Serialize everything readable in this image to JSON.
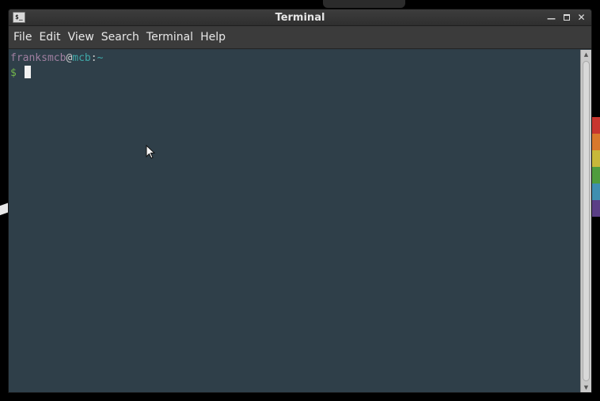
{
  "window": {
    "title": "Terminal",
    "icon_label": "$_",
    "controls": {
      "minimize": "minimize-icon",
      "maximize": "maximize-icon",
      "close": "close-icon"
    }
  },
  "menubar": {
    "items": [
      {
        "label": "File"
      },
      {
        "label": "Edit"
      },
      {
        "label": "View"
      },
      {
        "label": "Search"
      },
      {
        "label": "Terminal"
      },
      {
        "label": "Help"
      }
    ]
  },
  "terminal": {
    "prompt": {
      "user": "franksmcb",
      "at": "@",
      "host": "mcb",
      "colon": ":",
      "path": "~",
      "symbol": "$"
    }
  },
  "colors": {
    "terminal_bg": "#2f3f49",
    "user": "#9f7fa0",
    "host": "#3fa8a8",
    "dollar": "#72b54b"
  }
}
